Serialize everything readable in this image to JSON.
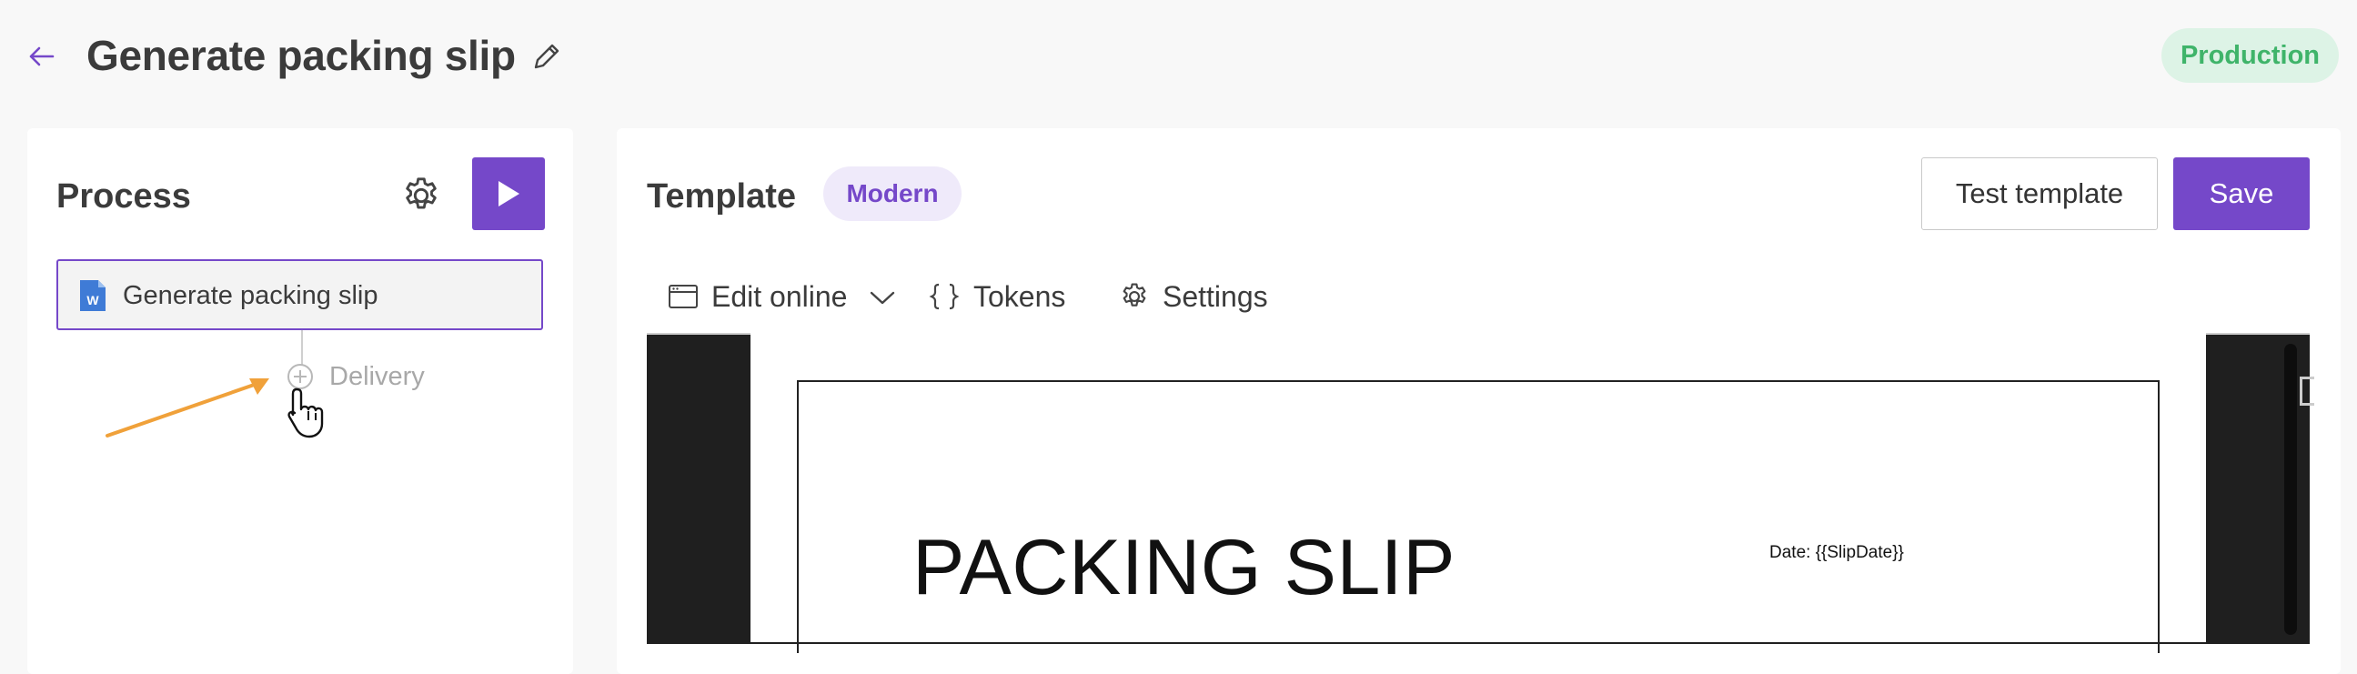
{
  "header": {
    "title": "Generate packing slip",
    "environment": "Production"
  },
  "process": {
    "title": "Process",
    "step": {
      "label": "Generate packing slip",
      "icon": "word-doc-icon"
    },
    "add_step_label": "Delivery"
  },
  "template": {
    "title": "Template",
    "style_badge": "Modern",
    "test_label": "Test template",
    "save_label": "Save",
    "tabs": [
      {
        "label": "Edit online",
        "icon": "browser-window-icon"
      },
      {
        "label": "Tokens",
        "icon": "braces-icon"
      },
      {
        "label": "Settings",
        "icon": "gear-icon"
      }
    ],
    "preview": {
      "heading": "PACKING SLIP",
      "date_line": "Date: {{SlipDate}}"
    }
  },
  "colors": {
    "accent": "#7548c9",
    "production_bg": "#ddf3e6",
    "production_text": "#3fb46a",
    "annotation_arrow": "#f0a13a"
  }
}
